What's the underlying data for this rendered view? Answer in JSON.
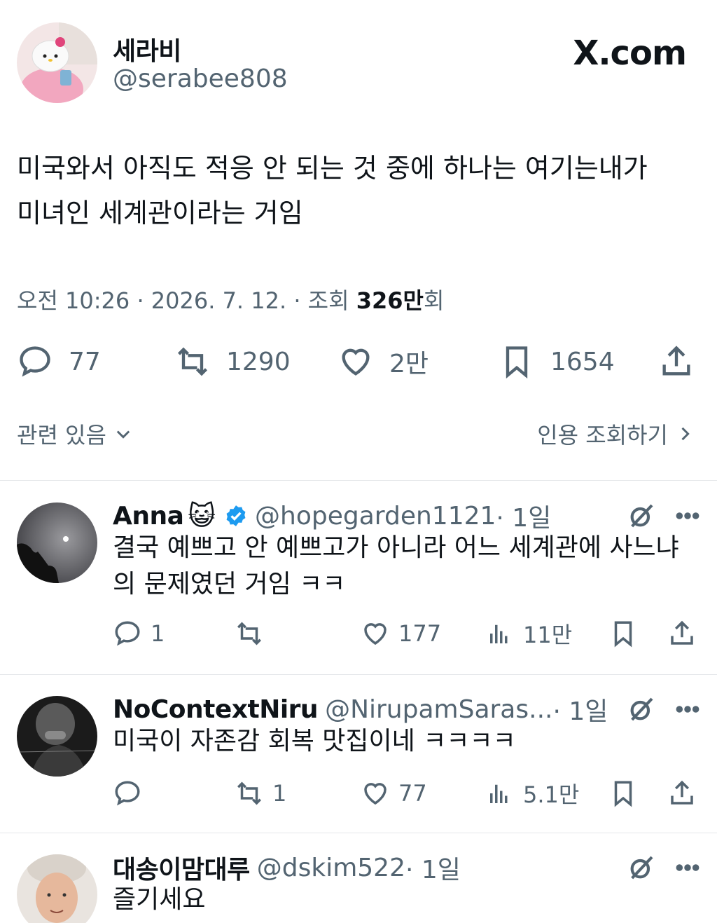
{
  "post": {
    "author_name": "세라비",
    "author_handle": "@serabee808",
    "brand": "X.com",
    "text_line1": "미국와서 아직도 적응 안 되는 것 중에 하나는 여기는내가",
    "text_line2": "미녀인 세계관이라는 거임",
    "meta_prefix": "오전 10:26 · 2026. 7. 12. · 조회 ",
    "meta_views": "326만",
    "meta_suffix": "회",
    "replies": "77",
    "reposts": "1290",
    "likes": "2만",
    "bookmarks": "1654",
    "related_label": "관련 있음",
    "quotes_label": "인용 조회하기"
  },
  "replies": [
    {
      "name": "Anna",
      "emoji": "😺",
      "handle": "@hopegarden1121",
      "time": " · 1일",
      "line1": "결국 예쁘고 안 예쁘고가 아니라 어느 세계관에 사느냐",
      "line2": "의 문제였던 거임 ㅋㅋ",
      "replies": "1",
      "reposts": "",
      "likes": "177",
      "views": "11만"
    },
    {
      "name": "NoContextNiru",
      "handle": "@NirupamSaras...",
      "time": " · 1일",
      "line1": "미국이 자존감 회복 맛집이네 ㅋㅋㅋㅋ",
      "replies": "",
      "reposts": "1",
      "likes": "77",
      "views": "5.1만"
    },
    {
      "name": "대송이맘대루",
      "handle": "@dskim522",
      "time": " · 1일",
      "line1": "즐기세요"
    }
  ],
  "colors": {
    "text": "#0f1419",
    "muted": "#536471",
    "divider": "#e5e7ea",
    "verified": "#1d9bf0"
  },
  "icons": [
    "reply-icon",
    "repost-icon",
    "like-icon",
    "bookmark-icon",
    "share-icon",
    "views-icon",
    "grok-icon",
    "more-icon",
    "verified-badge-icon",
    "chevron-down-icon",
    "chevron-right-icon"
  ]
}
